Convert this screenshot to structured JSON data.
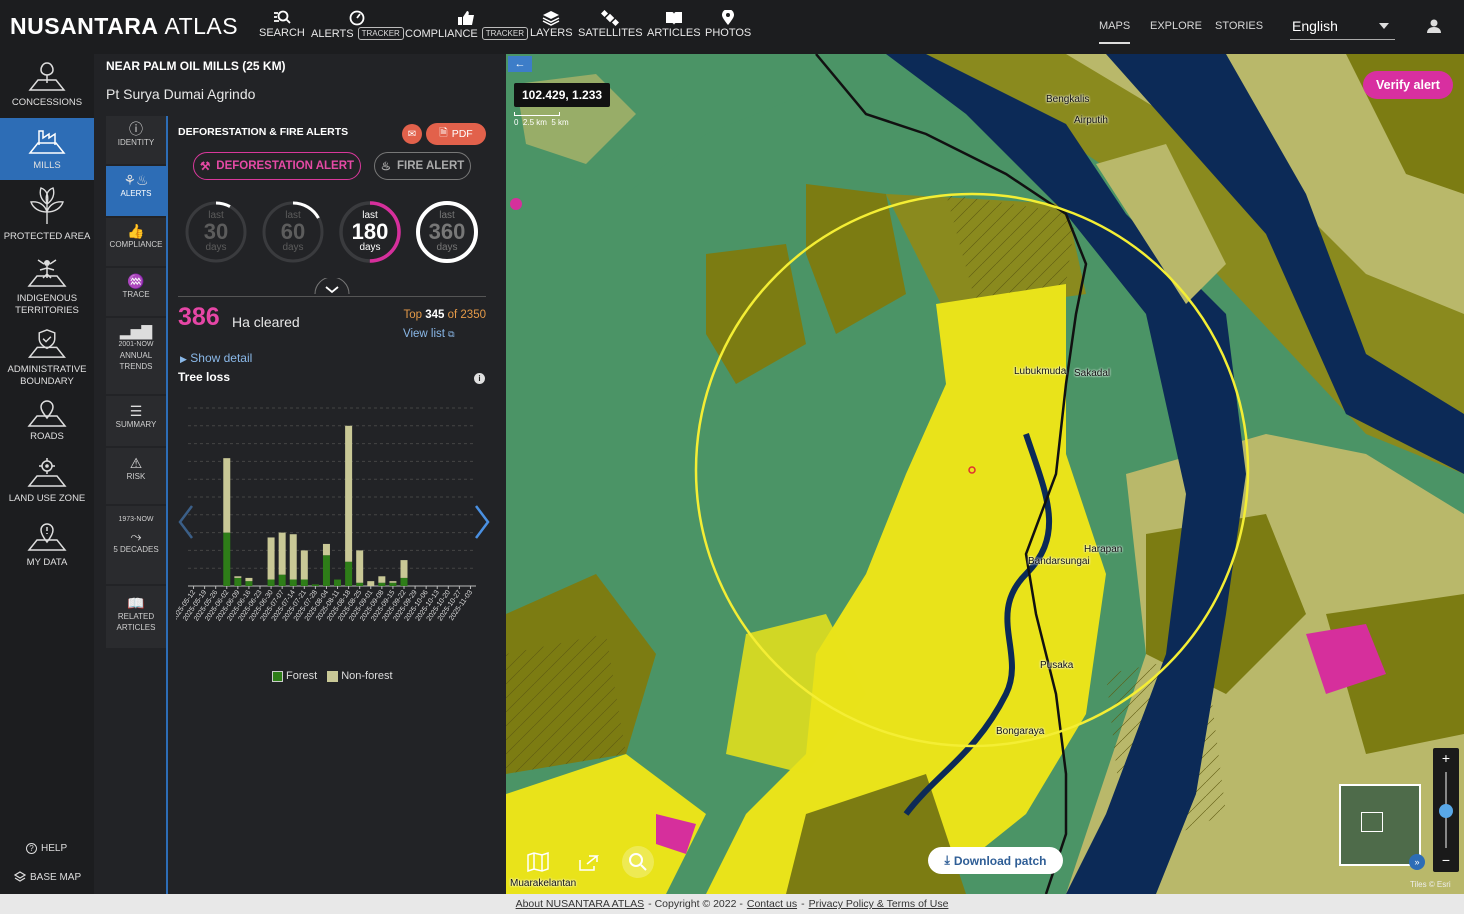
{
  "app": {
    "brand_bold": "NUSANTARA",
    "brand_light": "ATLAS"
  },
  "topnav": {
    "items": [
      {
        "label": "SEARCH",
        "icon": "search-icon"
      },
      {
        "label": "ALERTS",
        "badge": "TRACKER",
        "icon": "alert-gauge-icon"
      },
      {
        "label": "COMPLIANCE",
        "badge": "TRACKER",
        "icon": "thumbs-up-icon"
      },
      {
        "label": "LAYERS",
        "icon": "layers-icon"
      },
      {
        "label": "SATELLITES",
        "icon": "satellite-icon"
      },
      {
        "label": "ARTICLES",
        "icon": "book-icon"
      },
      {
        "label": "PHOTOS",
        "icon": "map-pin-icon"
      }
    ],
    "right": [
      "MAPS",
      "EXPLORE",
      "STORIES"
    ],
    "language": "English"
  },
  "sidebar": {
    "items": [
      {
        "label": "CONCESSIONS"
      },
      {
        "label": "MILLS",
        "active": true
      },
      {
        "label": "PROTECTED AREA"
      },
      {
        "label": "INDIGENOUS TERRITORIES"
      },
      {
        "label": "ADMINISTRATIVE BOUNDARY"
      },
      {
        "label": "ROADS"
      },
      {
        "label": "LAND USE ZONE"
      },
      {
        "label": "MY DATA"
      }
    ],
    "help": "HELP",
    "basemap": "BASE MAP"
  },
  "panel": {
    "title": "NEAR PALM OIL MILLS (25 KM)",
    "subtitle": "Pt Surya Dumai Agrindo",
    "subtabs": [
      {
        "label": "IDENTITY"
      },
      {
        "label": "ALERTS",
        "active": true
      },
      {
        "label": "COMPLIANCE"
      },
      {
        "label": "TRACE"
      },
      {
        "label_top": "2001-NOW",
        "label": "ANNUAL TRENDS"
      },
      {
        "label": "SUMMARY"
      },
      {
        "label": "RISK"
      },
      {
        "label_top": "1973-NOW",
        "label": "5 DECADES"
      },
      {
        "label": "RELATED ARTICLES"
      }
    ],
    "section_title": "DEFORESTATION & FIRE ALERTS",
    "pdf_label": "PDF",
    "deforestation_btn": "DEFORESTATION ALERT",
    "fire_btn": "FIRE ALERT",
    "periods": [
      {
        "top": "last",
        "value": "30",
        "unit": "days",
        "progress": 0.08
      },
      {
        "top": "last",
        "value": "60",
        "unit": "days",
        "progress": 0.17
      },
      {
        "top": "last",
        "value": "180",
        "unit": "days",
        "progress": 0.5,
        "selected": true
      },
      {
        "top": "last",
        "value": "360",
        "unit": "days",
        "progress": 1.0
      }
    ],
    "cleared_value": "386",
    "cleared_label": "Ha cleared",
    "rank_prefix": "Top",
    "rank_value": "345",
    "rank_of": "of 2350",
    "view_list": "View list",
    "show_detail": "Show detail",
    "tree_loss": "Tree loss"
  },
  "chart_data": {
    "type": "bar",
    "stacked": true,
    "categories": [
      "2025-05-12",
      "2025-05-19",
      "2025-05-26",
      "2025-06-02",
      "2025-06-09",
      "2025-06-16",
      "2025-06-23",
      "2025-06-30",
      "2025-07-07",
      "2025-07-14",
      "2025-07-21",
      "2025-07-28",
      "2025-08-04",
      "2025-08-11",
      "2025-08-18",
      "2025-08-25",
      "2025-09-01",
      "2025-09-08",
      "2025-09-15",
      "2025-09-22",
      "2025-09-29",
      "2025-10-06",
      "2025-10-13",
      "2025-10-20",
      "2025-10-27",
      "2025-11-03"
    ],
    "series": [
      {
        "name": "Forest",
        "values": [
          0,
          0,
          0,
          33,
          5,
          3,
          0,
          4,
          7,
          4,
          4,
          1,
          19,
          4,
          15,
          2,
          0,
          2,
          2,
          5,
          0,
          0,
          0,
          0,
          0,
          0
        ],
        "color": "#2e7d18"
      },
      {
        "name": "Non-forest",
        "values": [
          0,
          0,
          0,
          46,
          1,
          2,
          0,
          26,
          26,
          28,
          18,
          0,
          7,
          0,
          84,
          20,
          3,
          4,
          1,
          11,
          0,
          0,
          0,
          0,
          0,
          0
        ],
        "color": "#c9c896"
      }
    ],
    "ylim": [
      0,
      110
    ]
  },
  "map": {
    "coordinates": "102.429, 1.233",
    "scale_labels": [
      "0",
      "2.5 km",
      "5 km"
    ],
    "verify_alert": "Verify alert",
    "download_patch": "Download patch",
    "places": [
      "Bengkalis",
      "Airputih",
      "Lubukmuda",
      "Sakadal",
      "Harapan",
      "Bandarsungai",
      "Pusaka",
      "Bongaraya",
      "Muarakelantan"
    ],
    "attribution": "Tiles © Esri"
  },
  "footer": {
    "about": "About  NUSANTARA ATLAS",
    "copyright": "- Copyright ©  2022 -",
    "contact": "Contact us",
    "separator": "-",
    "policy": "Privacy Policy & Terms of Use"
  }
}
